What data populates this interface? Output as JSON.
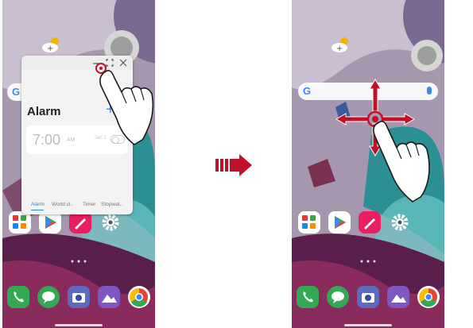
{
  "left_screen": {
    "popup": {
      "title": "Alarm",
      "add_label": "+",
      "alarm_time": "7:00",
      "alarm_ampm": "AM",
      "alarm_date": "Jan 1",
      "tabs": [
        "Alarm",
        "World cl..",
        "Timer",
        "Stopwat.."
      ],
      "active_tab_index": 0
    },
    "search_g": "G"
  },
  "right_screen": {
    "search_g": "G"
  },
  "colors": {
    "accent_blue": "#1e88e5",
    "arrow_red": "#c0112a",
    "hand_outline": "#1a1a1a"
  },
  "icons": [
    "weather-icon",
    "folder-icon",
    "play-store-icon",
    "pen-icon",
    "settings-icon",
    "phone-icon",
    "messages-icon",
    "camera-icon",
    "gallery-icon",
    "chrome-icon",
    "transition-arrow-icon",
    "drag-move-arrows-icon",
    "pointing-hand-icon"
  ]
}
